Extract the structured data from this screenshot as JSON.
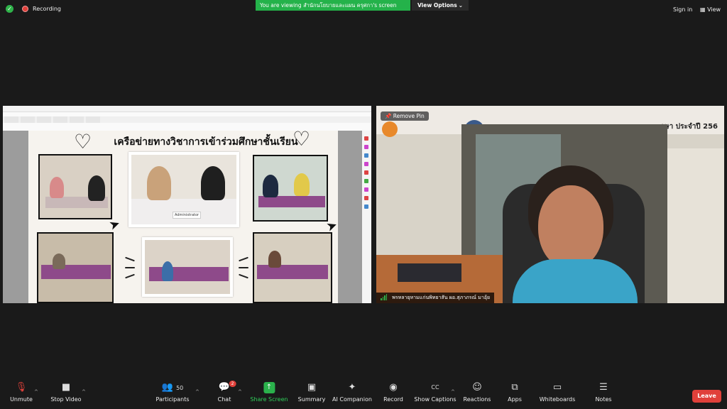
{
  "top": {
    "recording": "Recording",
    "viewing": "You are viewing สำนักนโยบายและแผน ครุศกา's screen",
    "view_options": "View Options",
    "sign_in": "Sign in",
    "view": "View"
  },
  "share": {
    "doc_title": "เครือข่ายทางวิชาการเข้าร่วมศึกษาชั้นเรียน",
    "placard": "Administrator"
  },
  "video": {
    "remove_pin": "Remove Pin",
    "backdrop_text": "กษา ประจำปี 256",
    "participant_name": "พรหลายุหามแก่นพิทยาสัน ผอ.สุภาภรณ์ มาอุ้ย"
  },
  "toolbar": {
    "unmute": "Unmute",
    "stop_video": "Stop Video",
    "participants": "Participants",
    "participants_count": "50",
    "chat": "Chat",
    "chat_badge": "2",
    "share_screen": "Share Screen",
    "summary": "Summary",
    "ai_companion": "AI Companion",
    "record": "Record",
    "show_captions": "Show Captions",
    "reactions": "Reactions",
    "apps": "Apps",
    "whiteboards": "Whiteboards",
    "notes": "Notes",
    "leave": "Leave"
  },
  "colors": {
    "background": "#1a1a1a",
    "green": "#24b24a",
    "leave": "#e0403a"
  }
}
